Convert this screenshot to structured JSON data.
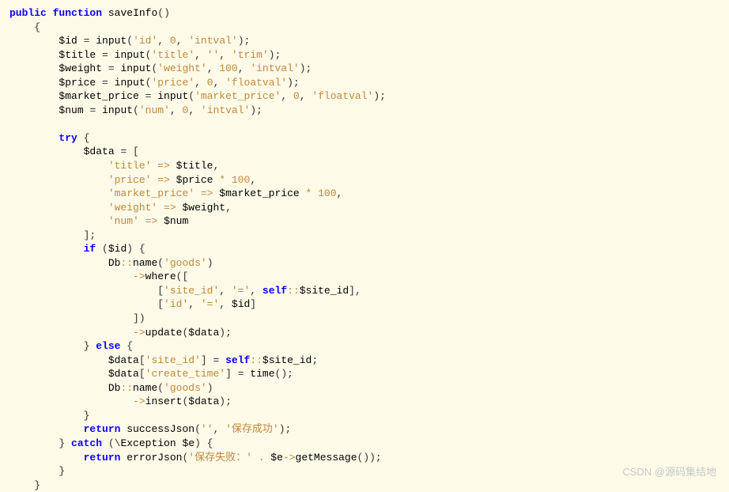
{
  "code": {
    "l1": {
      "kw1": "public",
      "kw2": "function",
      "name": "saveInfo",
      "paren": "()"
    },
    "l2": "    {",
    "l3": {
      "indent": "        ",
      "var": "$id",
      "eq": " = ",
      "fn": "input",
      "args_a": "(",
      "s1": "'id'",
      "c1": ", ",
      "n1": "0",
      "c2": ", ",
      "s2": "'intval'",
      "args_z": ");"
    },
    "l4": {
      "indent": "        ",
      "var": "$title",
      "eq": " = ",
      "fn": "input",
      "args_a": "(",
      "s1": "'title'",
      "c1": ", ",
      "s2": "''",
      "c2": ", ",
      "s3": "'trim'",
      "args_z": ");"
    },
    "l5": {
      "indent": "        ",
      "var": "$weight",
      "eq": " = ",
      "fn": "input",
      "args_a": "(",
      "s1": "'weight'",
      "c1": ", ",
      "n1": "100",
      "c2": ", ",
      "s2": "'intval'",
      "args_z": ");"
    },
    "l6": {
      "indent": "        ",
      "var": "$price",
      "eq": " = ",
      "fn": "input",
      "args_a": "(",
      "s1": "'price'",
      "c1": ", ",
      "n1": "0",
      "c2": ", ",
      "s2": "'floatval'",
      "args_z": ");"
    },
    "l7": {
      "indent": "        ",
      "var": "$market_price",
      "eq": " = ",
      "fn": "input",
      "args_a": "(",
      "s1": "'market_price'",
      "c1": ", ",
      "n1": "0",
      "c2": ", ",
      "s2": "'floatval'",
      "args_z": ");"
    },
    "l8": {
      "indent": "        ",
      "var": "$num",
      "eq": " = ",
      "fn": "input",
      "args_a": "(",
      "s1": "'num'",
      "c1": ", ",
      "n1": "0",
      "c2": ", ",
      "s2": "'intval'",
      "args_z": ");"
    },
    "blank1": "",
    "l9": {
      "indent": "        ",
      "kw": "try",
      "brace": " {"
    },
    "l10": {
      "indent": "            ",
      "var": "$data",
      "eq": " = ["
    },
    "l11": {
      "indent": "                ",
      "key": "'title'",
      "arrow": " => ",
      "val": "$title",
      "comma": ","
    },
    "l12": {
      "indent": "                ",
      "key": "'price'",
      "arrow": " => ",
      "val": "$price",
      "op": " * ",
      "num": "100",
      "comma": ","
    },
    "l13": {
      "indent": "                ",
      "key": "'market_price'",
      "arrow": " => ",
      "val": "$market_price",
      "op": " * ",
      "num": "100",
      "comma": ","
    },
    "l14": {
      "indent": "                ",
      "key": "'weight'",
      "arrow": " => ",
      "val": "$weight",
      "comma": ","
    },
    "l15": {
      "indent": "                ",
      "key": "'num'",
      "arrow": " => ",
      "val": "$num"
    },
    "l16": "            ];",
    "l17": {
      "indent": "            ",
      "kw": "if",
      "cond_a": " (",
      "var": "$id",
      "cond_z": ") {"
    },
    "l18": {
      "indent": "                ",
      "cls": "Db",
      "op": "::",
      "fn": "name",
      "args_a": "(",
      "s1": "'goods'",
      "args_z": ")"
    },
    "l19": {
      "indent": "                    ",
      "arrow": "->",
      "fn": "where",
      "args": "(["
    },
    "l20": {
      "indent": "                        [",
      "s1": "'site_id'",
      "c1": ", ",
      "s2": "'='",
      "c2": ", ",
      "self": "self",
      "op": "::",
      "var": "$site_id",
      "close": "],"
    },
    "l21": {
      "indent": "                        [",
      "s1": "'id'",
      "c1": ", ",
      "s2": "'='",
      "c2": ", ",
      "var": "$id",
      "close": "]"
    },
    "l22": "                    ])",
    "l23": {
      "indent": "                    ",
      "arrow": "->",
      "fn": "update",
      "args_a": "(",
      "var": "$data",
      "args_z": ");"
    },
    "l24": {
      "indent": "            } ",
      "kw": "else",
      "brace": " {"
    },
    "l25": {
      "indent": "                ",
      "var": "$data",
      "idx_a": "[",
      "key": "'site_id'",
      "idx_z": "]",
      "eq": " = ",
      "self": "self",
      "op": "::",
      "var2": "$site_id",
      "semi": ";"
    },
    "l26": {
      "indent": "                ",
      "var": "$data",
      "idx_a": "[",
      "key": "'create_time'",
      "idx_z": "]",
      "eq": " = ",
      "fn": "time",
      "args": "();",
      "semi": ""
    },
    "l27": {
      "indent": "                ",
      "cls": "Db",
      "op": "::",
      "fn": "name",
      "args_a": "(",
      "s1": "'goods'",
      "args_z": ")"
    },
    "l28": {
      "indent": "                    ",
      "arrow": "->",
      "fn": "insert",
      "args_a": "(",
      "var": "$data",
      "args_z": ");"
    },
    "l29": "            }",
    "l30": {
      "indent": "            ",
      "kw": "return",
      "sp": " ",
      "fn": "successJson",
      "args_a": "(",
      "s1": "''",
      "c1": ", ",
      "s2": "'保存成功'",
      "args_z": ");"
    },
    "l31": {
      "indent": "        } ",
      "kw": "catch",
      "paren_a": " (\\",
      "cls": "Exception",
      "sp": " ",
      "var": "$e",
      "paren_z": ") {"
    },
    "l32": {
      "indent": "            ",
      "kw": "return",
      "sp": " ",
      "fn": "errorJson",
      "args_a": "(",
      "s1": "'保存失败：'",
      "op": " . ",
      "var": "$e",
      "arrow": "->",
      "fn2": "getMessage",
      "args_z": "());"
    },
    "l33": "        }",
    "l34": "    }"
  },
  "watermark": "CSDN @源码集结地"
}
